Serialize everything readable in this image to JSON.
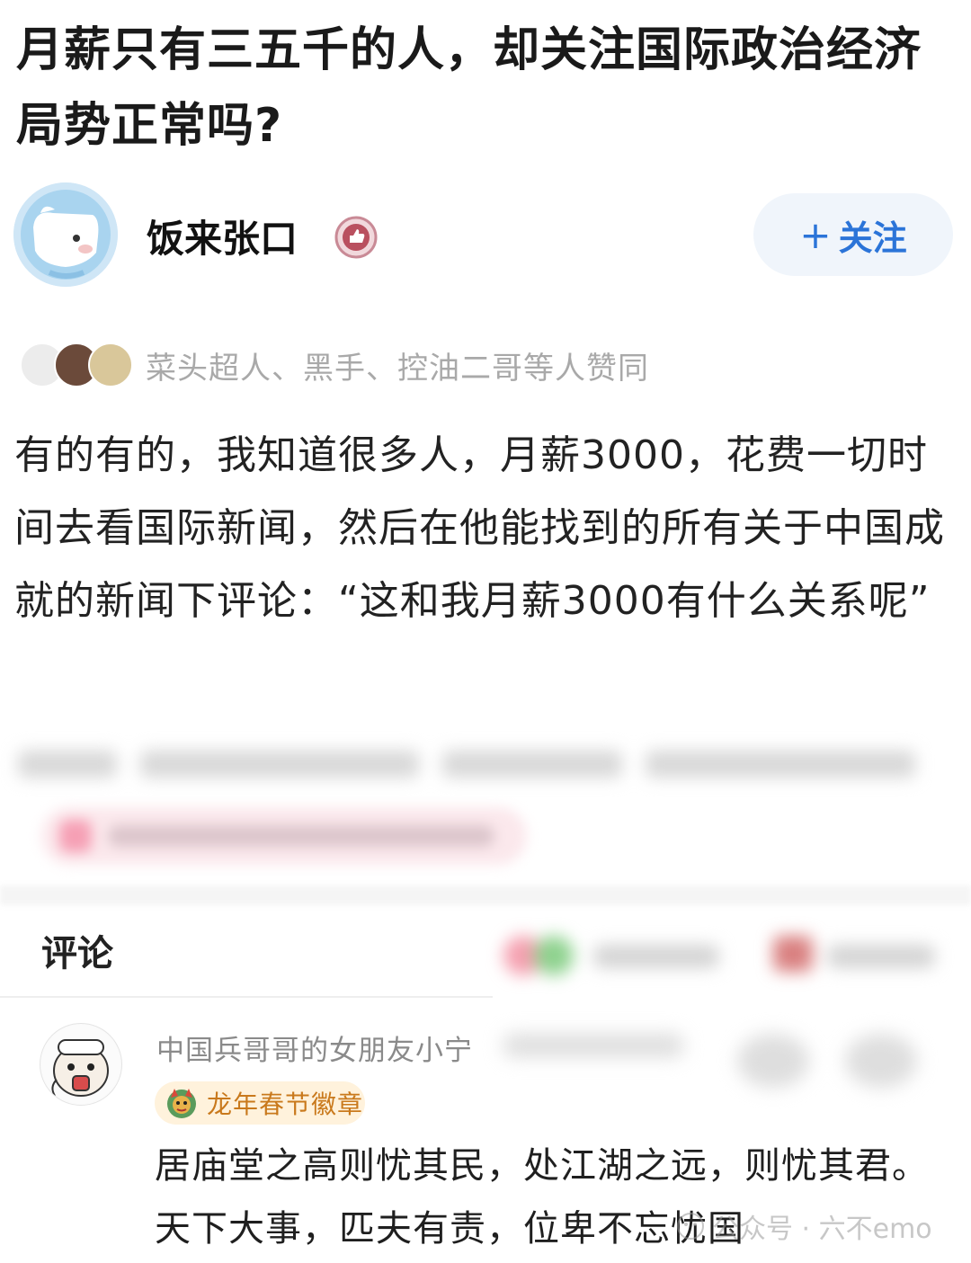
{
  "question": {
    "title": "月薪只有三五千的人，却关注国际政治经济局势正常吗?"
  },
  "author": {
    "name": "饭来张口",
    "badge_icon": "thumbs-up-badge-icon",
    "avatar_icon": "cartoon-dog-avatar"
  },
  "follow_button": {
    "plus": "+",
    "label": "关注",
    "color": "#2b74d8"
  },
  "likers": {
    "text": "菜头超人、黑手、控油二哥等人赞同"
  },
  "answer": {
    "body": "有的有的，我知道很多人，月薪3000，花费一切时间去看国际新闻，然后在他能找到的所有关于中国成就的新闻下评论：“这和我月薪3000有什么关系呢”"
  },
  "comments": {
    "heading": "评论",
    "first": {
      "username": "中国兵哥哥的女朋友小宁",
      "badge_label": "龙年春节徽章",
      "badge_icon": "dragon-icon",
      "text": "居庙堂之高则忧其民，处江湖之远，则忧其君。天下大事，匹夫有责，位卑不忘忧国"
    }
  },
  "watermark": {
    "text": "公众号 · 六不emo"
  },
  "colors": {
    "accent_blue": "#2b74d8",
    "badge_orange": "#c9791c",
    "muted_text": "#a9a9a9"
  }
}
